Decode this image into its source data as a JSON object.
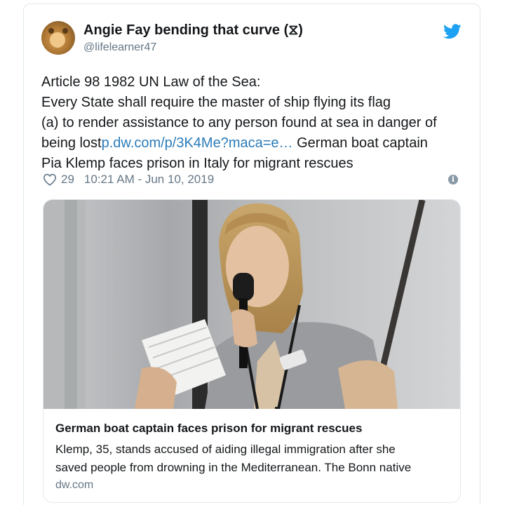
{
  "tweet": {
    "author": {
      "display_name": "Angie Fay bending that curve (⧖)",
      "handle": "@lifelearner47",
      "avatar_icon": "avatar-photo"
    },
    "text_lines": [
      "Article 98 1982 UN Law of the Sea:",
      "Every State shall require the master of ship flying its flag",
      "(a) to render assistance to any person found at sea in danger of"
    ],
    "line4_prefix": "being lost",
    "link_text": "p.dw.com/p/3K4Me?maca=e…",
    "line4_suffix": " German boat captain",
    "line5": "Pia Klemp faces prison in Italy for migrant rescues",
    "likes": "29",
    "timestamp": "10:21 AM - Jun 10, 2019"
  },
  "link_card": {
    "title": "German boat captain faces prison for migrant rescues",
    "description_lines": [
      "Klemp, 35, stands accused of aiding illegal immigration after she",
      "saved people from drowning in the Mediterranean. The Bonn native"
    ],
    "domain": "dw.com"
  },
  "colors": {
    "link": "#2b7bb9",
    "twitter_blue": "#1da1f2",
    "muted": "#657786",
    "border": "#e1e8ed"
  }
}
